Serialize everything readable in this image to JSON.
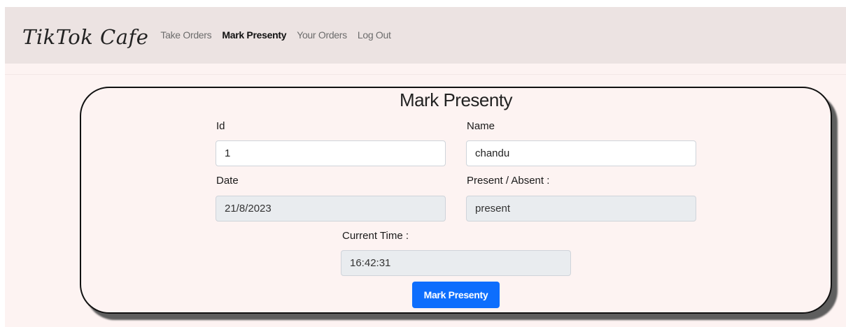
{
  "navbar": {
    "brand": "TikTok Cafe",
    "links": [
      {
        "label": "Take Orders",
        "active": false
      },
      {
        "label": "Mark Presenty",
        "active": true
      },
      {
        "label": "Your Orders",
        "active": false
      },
      {
        "label": "Log Out",
        "active": false
      }
    ]
  },
  "form": {
    "title": "Mark Presenty",
    "id": {
      "label": "Id",
      "value": "1"
    },
    "name": {
      "label": "Name",
      "value": "chandu"
    },
    "date": {
      "label": "Date",
      "value": "21/8/2023"
    },
    "status": {
      "label": "Present / Absent :",
      "value": "present"
    },
    "time": {
      "label": "Current Time :",
      "value": "16:42:31"
    },
    "submit_label": "Mark Presenty"
  },
  "colors": {
    "navbar_bg": "#ece3e2",
    "content_bg": "#fdf3f2",
    "primary_button": "#0d6efd",
    "readonly_input_bg": "#e9ecef"
  }
}
